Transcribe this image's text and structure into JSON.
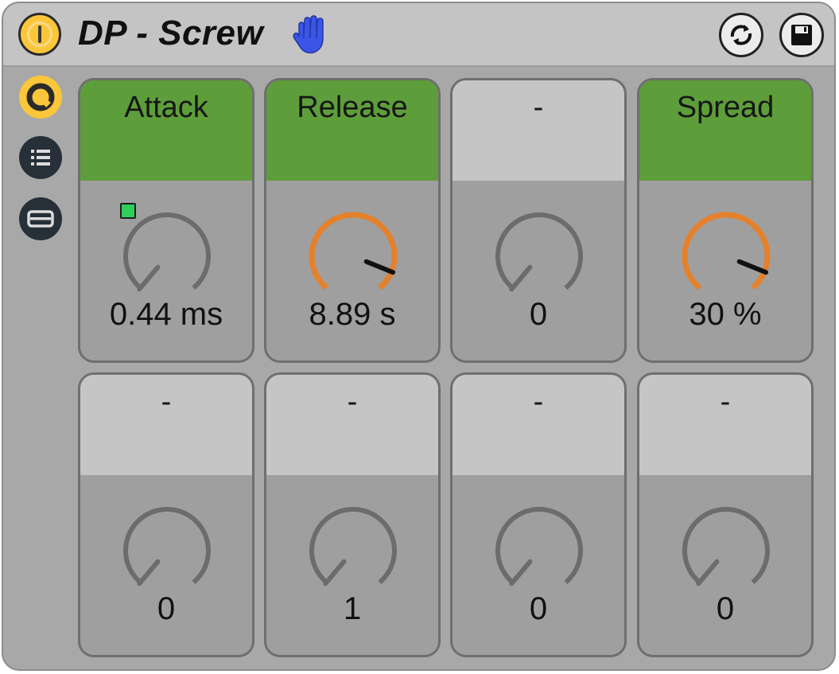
{
  "device": {
    "title": "DP - Screw",
    "icons": {
      "power": "power-icon",
      "hand": "hand-icon",
      "refresh": "refresh-icon",
      "save": "save-icon"
    }
  },
  "sidebar": [
    {
      "name": "knob-view-icon",
      "active": true
    },
    {
      "name": "list-icon",
      "active": false
    },
    {
      "name": "panel-icon",
      "active": false
    }
  ],
  "colors": {
    "active_header": "#5d9e3a",
    "inactive_header": "#c5c5c5",
    "knob_active": "#e5802b",
    "knob_inactive": "#6c6c6c",
    "power_yellow": "#fbc63a",
    "hand_blue": "#3b55e6",
    "led_green": "#2ed05a"
  },
  "macros": [
    {
      "label": "Attack",
      "value": "0.44 ms",
      "active": true,
      "level": 0.0,
      "led": true
    },
    {
      "label": "Release",
      "value": "8.89 s",
      "active": true,
      "level": 0.9,
      "led": false
    },
    {
      "label": "-",
      "value": "0",
      "active": false,
      "level": 0.0,
      "led": false
    },
    {
      "label": "Spread",
      "value": "30 %",
      "active": true,
      "level": 0.9,
      "led": false
    },
    {
      "label": "-",
      "value": "0",
      "active": false,
      "level": 0.0,
      "led": false
    },
    {
      "label": "-",
      "value": "1",
      "active": false,
      "level": 0.0,
      "led": false
    },
    {
      "label": "-",
      "value": "0",
      "active": false,
      "level": 0.0,
      "led": false
    },
    {
      "label": "-",
      "value": "0",
      "active": false,
      "level": 0.0,
      "led": false
    }
  ]
}
